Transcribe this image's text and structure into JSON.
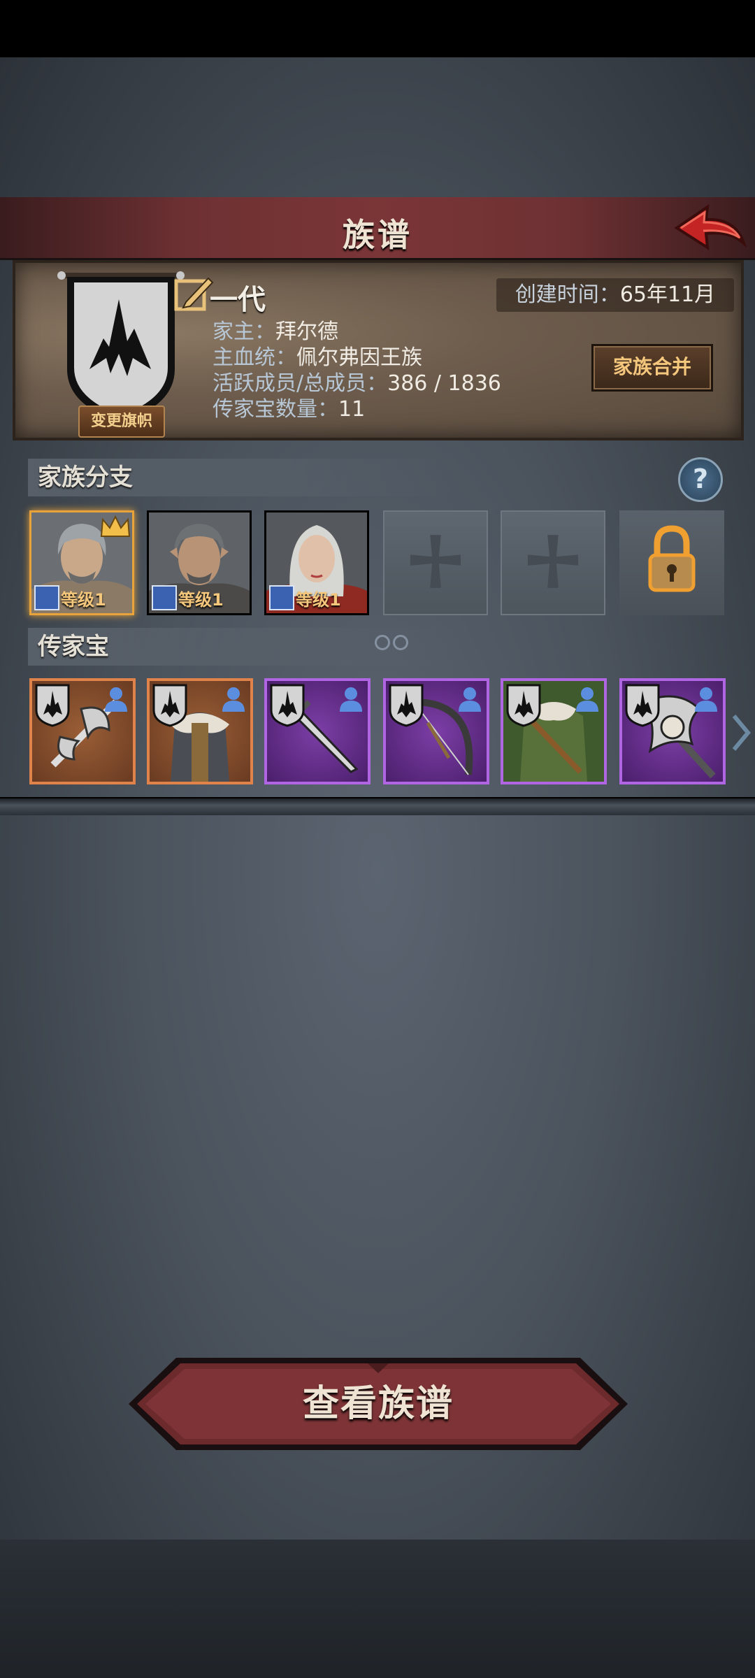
{
  "screen": {
    "title": "族谱",
    "back_icon": "red-back-arrow-icon"
  },
  "family": {
    "banner_change_label": "变更旗帜",
    "generation": "一代",
    "created_label": "创建时间：",
    "created_value": "65年11月",
    "info": [
      {
        "key": "家主：",
        "value": "拜尔德"
      },
      {
        "key": "主血统：",
        "value": "佩尔弗因王族"
      },
      {
        "key": "活跃成员/总成员：",
        "value": "386 / 1836"
      },
      {
        "key": "传家宝数量：",
        "value": "11"
      }
    ],
    "merge_label": "家族合并"
  },
  "branches": {
    "header": "家族分支",
    "help_label": "?",
    "members": [
      {
        "level_label": "等级1",
        "leader": true
      },
      {
        "level_label": "等级1",
        "leader": false
      },
      {
        "level_label": "等级1",
        "leader": false
      }
    ],
    "empty_slots": 2,
    "locked_slots": 1
  },
  "heirlooms": {
    "header": "传家宝",
    "page_indicator": {
      "pages": 2,
      "current": 1
    },
    "items": [
      {
        "name": "halberd-icon",
        "rarity": "orange"
      },
      {
        "name": "fur-armor-icon",
        "rarity": "orange"
      },
      {
        "name": "greatsword-icon",
        "rarity": "purple"
      },
      {
        "name": "bow-icon",
        "rarity": "purple"
      },
      {
        "name": "leather-armor-icon",
        "rarity": "purple"
      },
      {
        "name": "battle-axe-icon",
        "rarity": "purple"
      }
    ],
    "colors": {
      "orange": "#e0834a",
      "purple": "#b065e3"
    }
  },
  "actions": {
    "view_tree_label": "查看族谱"
  }
}
